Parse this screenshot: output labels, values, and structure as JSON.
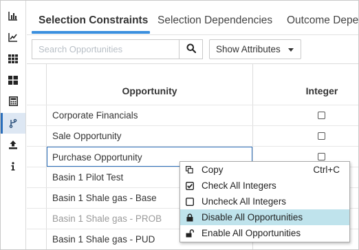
{
  "rail": {
    "items": [
      {
        "icon": "bar-chart-icon"
      },
      {
        "icon": "line-chart-icon"
      },
      {
        "icon": "grid-icon"
      },
      {
        "icon": "dashboard-icon"
      },
      {
        "icon": "calculator-icon"
      },
      {
        "icon": "branch-icon",
        "active": true
      },
      {
        "icon": "upload-icon"
      },
      {
        "icon": "info-icon"
      }
    ]
  },
  "tabs": [
    {
      "label": "Selection Constraints",
      "active": true
    },
    {
      "label": "Selection Dependencies"
    },
    {
      "label": "Outcome Depe"
    }
  ],
  "toolbar": {
    "search_placeholder": "Search Opportunities",
    "search_value": "",
    "attributes_label": "Show Attributes"
  },
  "grid": {
    "columns": [
      "Opportunity",
      "Integer"
    ],
    "rows": [
      {
        "name": "Corporate Financials",
        "integer": false
      },
      {
        "name": "Sale Opportunity",
        "integer": false
      },
      {
        "name": "Purchase Opportunity",
        "integer": false,
        "selected": true
      },
      {
        "name": "Basin 1 Pilot Test"
      },
      {
        "name": "Basin 1 Shale gas - Base"
      },
      {
        "name": "Basin 1 Shale gas - PROB",
        "disabled": true
      },
      {
        "name": "Basin 1 Shale gas - PUD"
      }
    ]
  },
  "context_menu": {
    "items": [
      {
        "label": "Copy",
        "shortcut": "Ctrl+C",
        "icon": "copy-icon"
      },
      {
        "label": "Check All Integers",
        "icon": "checked-box-icon"
      },
      {
        "label": "Uncheck All Integers",
        "icon": "unchecked-box-icon"
      },
      {
        "label": "Disable All Opportunities",
        "icon": "lock-icon",
        "highlighted": true
      },
      {
        "label": "Enable All Opportunities",
        "icon": "unlock-icon"
      }
    ]
  },
  "colors": {
    "accent": "#3a8fde",
    "menu_highlight": "#bfe3ec",
    "active_rail": "#dde7f3"
  }
}
